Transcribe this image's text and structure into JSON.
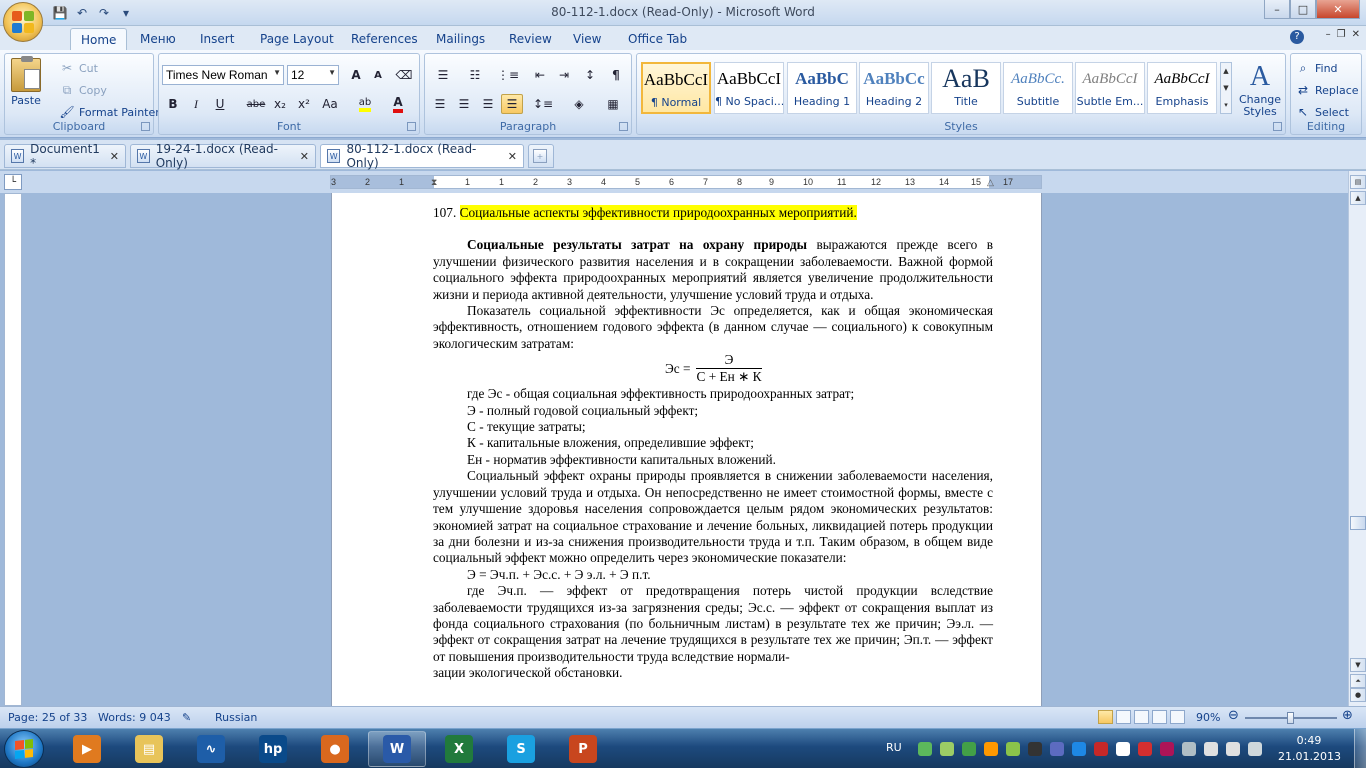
{
  "window": {
    "title": "80-112-1.docx (Read-Only) - Microsoft Word",
    "min": "–",
    "max": "□",
    "close": "✕"
  },
  "qat": {
    "save": "💾",
    "undo": "↶",
    "redo": "↷",
    "customize": "▾"
  },
  "ribbon_tabs": [
    "Home",
    "Меню",
    "Insert",
    "Page Layout",
    "References",
    "Mailings",
    "Review",
    "View",
    "Office Tab"
  ],
  "help": "?",
  "clipboard": {
    "paste": "Paste",
    "cut": "Cut",
    "copy": "Copy",
    "format_painter": "Format Painter",
    "label": "Clipboard"
  },
  "font": {
    "family": "Times New Roman",
    "size": "12",
    "label": "Font",
    "grow": "A",
    "shrink": "A",
    "bold": "B",
    "italic": "I",
    "underline": "U",
    "strike": "abe",
    "sub": "x₂",
    "sup": "x²",
    "case": "Aa",
    "highlight": "ab",
    "color": "A"
  },
  "paragraph": {
    "label": "Paragraph",
    "pilcrow": "¶"
  },
  "styles": {
    "label": "Styles",
    "items": [
      {
        "sample": "AaBbCcI",
        "name": "¶ Normal"
      },
      {
        "sample": "AaBbCcI",
        "name": "¶ No Spaci..."
      },
      {
        "sample": "AaBbC",
        "name": "Heading 1"
      },
      {
        "sample": "AaBbCc",
        "name": "Heading 2"
      },
      {
        "sample": "AaB",
        "name": "Title"
      },
      {
        "sample": "AaBbCc.",
        "name": "Subtitle"
      },
      {
        "sample": "AaBbCcI",
        "name": "Subtle Em..."
      },
      {
        "sample": "AaBbCcI",
        "name": "Emphasis"
      }
    ],
    "change_styles": "Change Styles"
  },
  "editing": {
    "label": "Editing",
    "find": "Find",
    "replace": "Replace",
    "select": "Select"
  },
  "doc_tabs": [
    {
      "label": "Document1 *"
    },
    {
      "label": "19-24-1.docx (Read-Only)"
    },
    {
      "label": "80-112-1.docx (Read-Only)"
    }
  ],
  "ruler": {
    "ticks": [
      "3",
      "2",
      "1",
      "1",
      "1",
      "2",
      "3",
      "4",
      "5",
      "6",
      "7",
      "8",
      "9",
      "10",
      "11",
      "12",
      "13",
      "14",
      "15",
      "16",
      "17"
    ]
  },
  "document": {
    "heading_num": "107.",
    "heading": "Социальные аспекты эффективности природоохранных мероприятий.",
    "p1_bold": "Социальные результаты затрат на охрану природы",
    "p1_rest": " выражаются прежде всего в улучшении физического развития населения и в сокращении заболеваемости. Важной формой социального эффекта природоохранных мероприятий является увеличение продолжительности жизни и периода активной деятельности, улучшение условий труда и отдыха.",
    "p2": "Показатель социальной эффективности Эс определяется, как и общая экономическая эффективность, отношением годового эффекта (в данном случае — социального) к совокупным экологическим затратам:",
    "formula_lhs": "Эс =",
    "formula_num": "Э",
    "formula_den": "С + Ен ∗ К",
    "defs": [
      "где Эс - общая социальная эффективность природоохранных затрат;",
      "Э - полный годовой социальный эффект;",
      "С - текущие затраты;",
      "К - капитальные вложения, определившие эффект;",
      "Ен - норматив эффективности капитальных вложений."
    ],
    "p3": "Социальный эффект охраны природы проявляется в снижении заболеваемости населения, улучшении условий труда и отдыха. Он непосредственно не имеет стоимостной формы, вместе с тем улучшение здоровья населения сопровождается целым рядом экономических результатов: экономией затрат на социальное страхование и лечение больных, ликвидацией потерь продукции за дни болезни и из-за снижения производительности труда и т.п. Таким образом, в общем виде социальный эффект можно определить через экономические показатели:",
    "formula2": "Э = Эч.п. +  Эс.с. + Э э.л. + Э п.т.",
    "p4": "где  Эч.п. — эффект от предотвращения потерь чистой продукции вследствие заболеваемости трудящихся из-за загрязнения среды; Эс.с. — эффект от сокращения выплат из фонда социального страхования (по больничным листам) в результате тех же причин; Ээ.л. — эффект от сокращения затрат на лечение трудящихся в результате тех же причин; Эп.т. — эффект от повышения производительности труда вследствие нормали-",
    "p4_cut": "зации экологической обстановки."
  },
  "status": {
    "page": "Page: 25 of 33",
    "words": "Words: 9 043",
    "language": "Russian",
    "zoom": "90%",
    "zoom_level": 0.5
  },
  "taskbar": {
    "lang": "RU",
    "time": "0:49",
    "date": "21.01.2013",
    "apps": [
      {
        "name": "media-player",
        "glyph": "▶",
        "color": "#e07a1f",
        "open": false
      },
      {
        "name": "explorer",
        "glyph": "▤",
        "color": "#e8c45a",
        "open": false
      },
      {
        "name": "activity-monitor",
        "glyph": "∿",
        "color": "#1e5ea8",
        "open": false
      },
      {
        "name": "hp",
        "glyph": "hp",
        "color": "#0a4a8a",
        "open": false
      },
      {
        "name": "firefox",
        "glyph": "●",
        "color": "#d9681e",
        "open": false
      },
      {
        "name": "word",
        "glyph": "W",
        "color": "#2a5aa8",
        "open": true
      },
      {
        "name": "excel",
        "glyph": "X",
        "color": "#217a3c",
        "open": false
      },
      {
        "name": "skype",
        "glyph": "S",
        "color": "#1aa0e0",
        "open": false
      },
      {
        "name": "powerpoint",
        "glyph": "P",
        "color": "#c8461e",
        "open": false
      }
    ]
  },
  "colors": {
    "highlight": "#ffff00",
    "accent": "#15428b"
  }
}
